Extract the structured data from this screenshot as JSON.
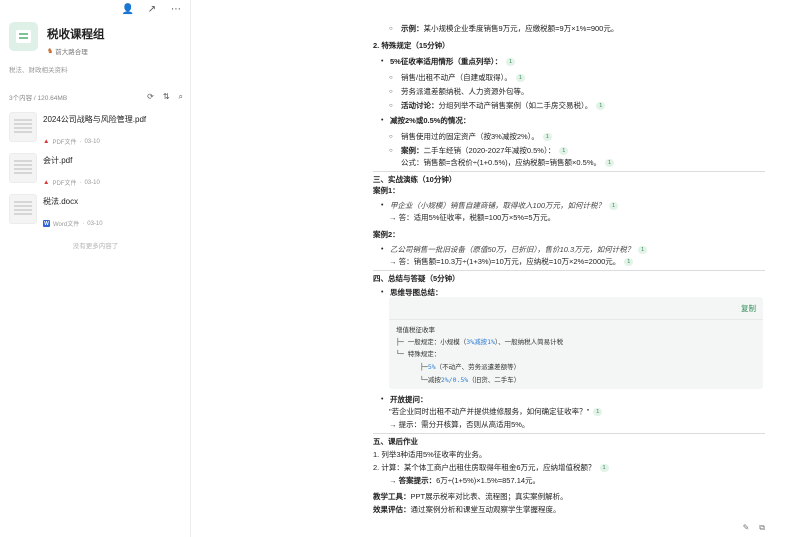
{
  "sidebar": {
    "group_title": "税收课程组",
    "owner": "前大路合理",
    "description": "税法、财政相关资料",
    "count": "3个内容 / 120.64MB",
    "files": [
      {
        "name": "2024公司战略与风险管理.pdf",
        "type": "PDF文件",
        "date": "03-10"
      },
      {
        "name": "会计.pdf",
        "type": "PDF文件",
        "date": "03-10"
      },
      {
        "name": "税法.docx",
        "type": "Word文件",
        "date": "03-10"
      }
    ],
    "no_more": "没有更多内容了"
  },
  "doc": {
    "l1_label": "示例：",
    "l1_text": "某小规模企业季度销售9万元，应缴税额=9万×1%=900元。",
    "h_special": "2. 特殊规定（15分钟）",
    "b1": "5%征收率适用情形（重点列举）：",
    "b1_1": "销售/出租不动产（自建或取得）。",
    "b1_2": "劳务派遣差额纳税、人力资源外包等。",
    "b1_3_label": "活动讨论：",
    "b1_3_text": "分组列举不动产销售案例（如二手房交易税）。",
    "b2": "减按2%或0.5%的情况：",
    "b2_1": "销售使用过的固定资产（按3%减按2%）。",
    "b2_2_label": "案例：",
    "b2_2_text": "二手车经销（2020-2027年减按0.5%）：",
    "b2_3": "公式：销售额=含税价÷(1+0.5%)，应纳税额=销售额×0.5%。",
    "h3": "三、实战演练（10分钟）",
    "case1": "案例1：",
    "case1_q": "甲企业（小规模）销售自建商铺，取得收入100万元，如何计税？",
    "case1_a": "→ 答：适用5%征收率，税额=100万×5%=5万元。",
    "case2": "案例2：",
    "case2_q": "乙公司销售一批旧设备（原值50万，已折旧），售价10.3万元，如何计税？",
    "case2_a": "→ 答：销售额=10.3万÷(1+3%)=10万元，应纳税=10万×2%=2000元。",
    "h4": "四、总结与答疑（5分钟）",
    "mindmap": "思维导图总结：",
    "copy": "复制",
    "code_1": "增值税征收率",
    "code_2a": "├─ 一般规定：小规模（",
    "code_2b": "3%减按1%",
    "code_2c": "）、一般纳税人简易计税",
    "code_3": "└─ 特殊规定：",
    "code_4a": "├─",
    "code_4b": "5%",
    "code_4c": "（不动产、劳务派遣差额等）",
    "code_5a": "└─减按",
    "code_5b": "2%/0.5%",
    "code_5c": "（旧货、二手车）",
    "open_q": "开放提问：",
    "open_q_text": "\"若企业同时出租不动产并提供维修服务，如何确定征收率？\"",
    "open_q_hint": "→ 提示：需分开核算，否则从高适用5%。",
    "h5": "五、课后作业",
    "hw1": "1.   列举3种适用5%征收率的业务。",
    "hw2": "2.   计算：某个体工商户出租住房取得年租金6万元，应纳增值税额？",
    "hw2_label": "→ 答案提示：",
    "hw2_text": "6万÷(1+5%)×1.5%=857.14元。",
    "tools_label": "教学工具：",
    "tools_text": "PPT展示税率对比表、流程图；真实案例解析。",
    "eval_label": "效果评估：",
    "eval_text": "通过案例分析和课堂互动观察学生掌握程度。",
    "cite": "1"
  }
}
